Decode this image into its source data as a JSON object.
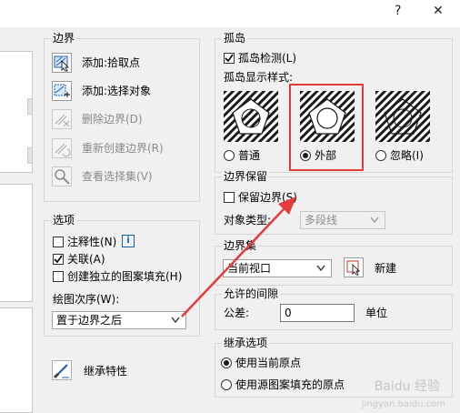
{
  "titlebar": {
    "help_glyph": "?",
    "close_glyph": "✕"
  },
  "boundaries": {
    "title": "边界",
    "add_pick_points": "添加:拾取点",
    "add_select_objects": "添加:选择对象",
    "remove_boundaries": "删除边界(D)",
    "recreate_boundary": "重新创建边界(R)",
    "view_selections": "查看选择集(V)"
  },
  "options": {
    "title": "选项",
    "annotative": "注释性(N)",
    "info_glyph": "i",
    "associative": "关联(A)",
    "separate_hatches": "创建独立的图案填充(H)",
    "draw_order_label": "绘图次序(W):",
    "draw_order_value": "置于边界之后"
  },
  "inherit": {
    "label": "继承特性"
  },
  "islands": {
    "title": "孤岛",
    "detection": "孤岛检测(L)",
    "display_style_label": "孤岛显示样式:",
    "style_normal": "普通",
    "style_outer": "外部",
    "style_ignore": "忽略(I)",
    "selected_style": "outer"
  },
  "boundary_retention": {
    "title": "边界保留",
    "retain": "保留边界(S)",
    "object_type_label": "对象类型:",
    "object_type_value": "多段线"
  },
  "boundary_set": {
    "title": "边界集",
    "value": "当前视口",
    "new_label": "新建"
  },
  "gap_tolerance": {
    "title": "允许的间隙",
    "tolerance_label": "公差:",
    "tolerance_value": "0",
    "unit_label": "单位"
  },
  "inherit_options": {
    "title": "继承选项",
    "use_current_origin": "使用当前原点",
    "use_source_origin": "使用源图案填充的原点"
  },
  "watermark": {
    "text": "Baidu 经验",
    "sub": "jingyan.baidu.com"
  },
  "colors": {
    "annotation_red": "#e53b3b",
    "accent_blue": "#1a5fb4"
  }
}
